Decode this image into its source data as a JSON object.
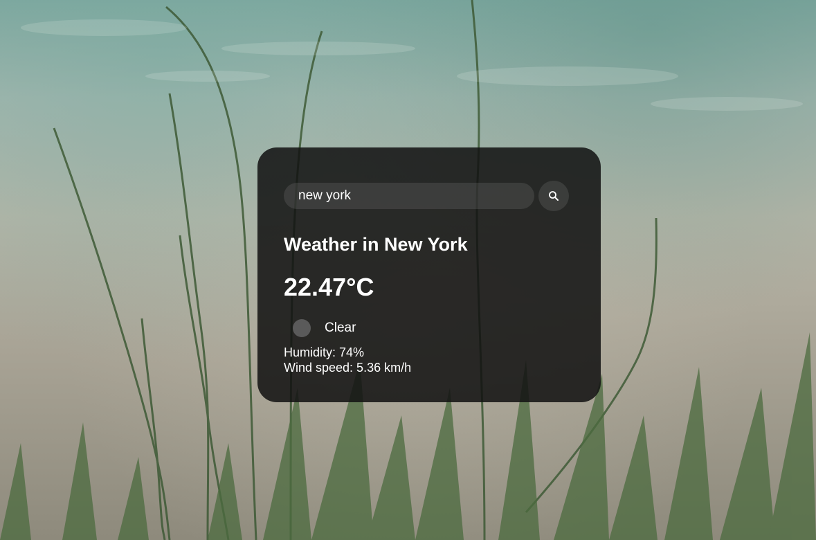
{
  "search": {
    "value": "new york",
    "placeholder": "Search",
    "button_icon": "search-icon"
  },
  "weather": {
    "title": "Weather in New York",
    "temperature": "22.47°C",
    "icon": "weather-clear-icon",
    "description": "Clear",
    "humidity": "Humidity: 74%",
    "wind": "Wind speed: 5.36 km/h"
  },
  "colors": {
    "card_background": "#121212",
    "text": "#ffffff",
    "input_background": "#7d7d7d",
    "icon_placeholder": "#5a5a5a"
  }
}
